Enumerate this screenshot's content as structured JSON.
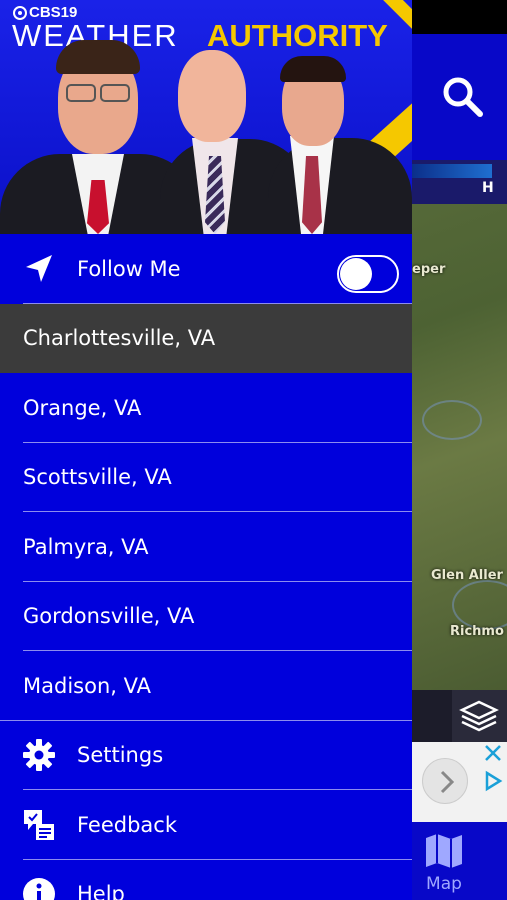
{
  "brand": {
    "station": "CBS19",
    "title_part1": "WEATHER",
    "title_part2": "AUTHORITY"
  },
  "follow_me": {
    "label": "Follow Me",
    "toggle_on": false
  },
  "locations": [
    {
      "label": "Charlottesville, VA",
      "selected": true
    },
    {
      "label": "Orange, VA",
      "selected": false
    },
    {
      "label": "Scottsville, VA",
      "selected": false
    },
    {
      "label": "Palmyra, VA",
      "selected": false
    },
    {
      "label": "Gordonsville, VA",
      "selected": false
    },
    {
      "label": "Madison, VA",
      "selected": false
    }
  ],
  "menu": {
    "settings": "Settings",
    "feedback": "Feedback",
    "help": "Help"
  },
  "map": {
    "legend_high": "H",
    "labels": [
      "eper",
      "Glen Aller",
      "Richmo"
    ]
  },
  "bottom_tab": {
    "map_label": "Map"
  },
  "colors": {
    "drawer_bg": "#0000dc",
    "selected_row": "#3b3b3b",
    "brand_accent": "#f5c800"
  }
}
